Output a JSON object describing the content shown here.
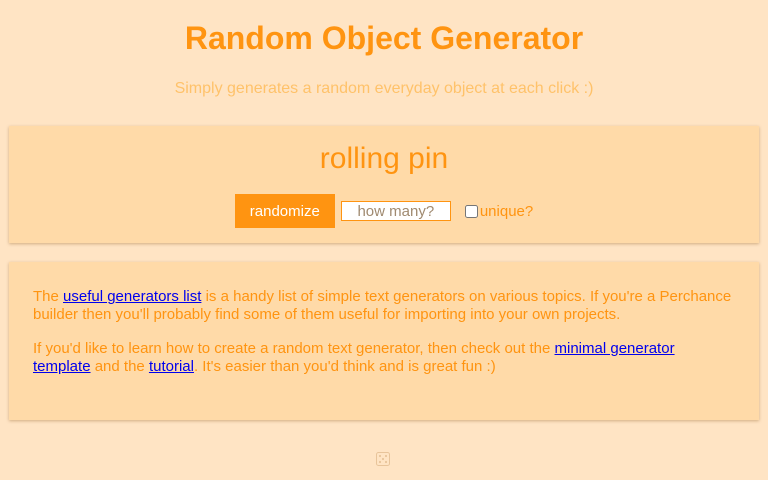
{
  "header": {
    "title": "Random Object Generator",
    "subtitle": "Simply generates a random everyday object at each click :)"
  },
  "output": {
    "text": "rolling pin"
  },
  "controls": {
    "randomize_label": "randomize",
    "count_placeholder": "how many?",
    "count_value": "",
    "unique_label": "unique?",
    "unique_checked": false
  },
  "info": {
    "p1_pre": "The ",
    "p1_link": "useful generators list",
    "p1_post": " is a handy list of simple text generators on various topics. If you're a Perchance builder then you'll probably find some of them useful for importing into your own projects.",
    "p2_pre": "If you'd like to learn how to create a random text generator, then check out the ",
    "p2_link1": "minimal generator template",
    "p2_mid": " and the ",
    "p2_link2": "tutorial",
    "p2_post": ". It's easier than you'd think and is great fun :)"
  },
  "footer": {
    "icon": "dice-icon"
  },
  "colors": {
    "background": "#ffe4c4",
    "card": "#ffdaa8",
    "accent": "#ff9411",
    "subtitle": "#ffc26a",
    "link": "#0000ee"
  }
}
